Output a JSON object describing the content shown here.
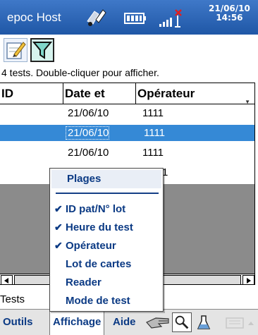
{
  "titlebar": {
    "title": "epoc Host",
    "date": "21/06/10",
    "time": "14:56",
    "icons": [
      "sync-icon",
      "battery-icon",
      "signal-icon"
    ]
  },
  "toolbar": {
    "buttons": [
      {
        "name": "edit-icon"
      },
      {
        "name": "filter-icon"
      }
    ]
  },
  "status_text": "4 tests. Double-cliquer pour afficher.",
  "table": {
    "columns": [
      "ID",
      "Date et",
      "Opérateur"
    ],
    "rows": [
      {
        "date": "21/06/10",
        "operator": "1111",
        "selected": false
      },
      {
        "date": "21/06/10",
        "operator": "1111",
        "selected": true
      },
      {
        "date": "21/06/10",
        "operator": "1111",
        "selected": false
      }
    ],
    "selection_color": "#3589d6"
  },
  "tabs": [
    {
      "label": "Tests"
    }
  ],
  "menubar": {
    "items": [
      "Outils",
      "Affichage",
      "Aide"
    ],
    "icons": [
      "hand-icon",
      "search-icon",
      "flask-icon",
      "keyboard-icon"
    ]
  },
  "popup_menu": {
    "title": "Plages",
    "items": [
      {
        "label": "ID pat/N° lot",
        "checked": true
      },
      {
        "label": "Heure du test",
        "checked": true
      },
      {
        "label": "Opérateur",
        "checked": true
      },
      {
        "label": "Lot de cartes",
        "checked": false
      },
      {
        "label": "Reader",
        "checked": false
      },
      {
        "label": "Mode de test",
        "checked": false
      }
    ]
  },
  "colors": {
    "title_bar": "#2b63b3",
    "menu_text": "#0b3a84",
    "grid_background": "#8b8b8b"
  }
}
